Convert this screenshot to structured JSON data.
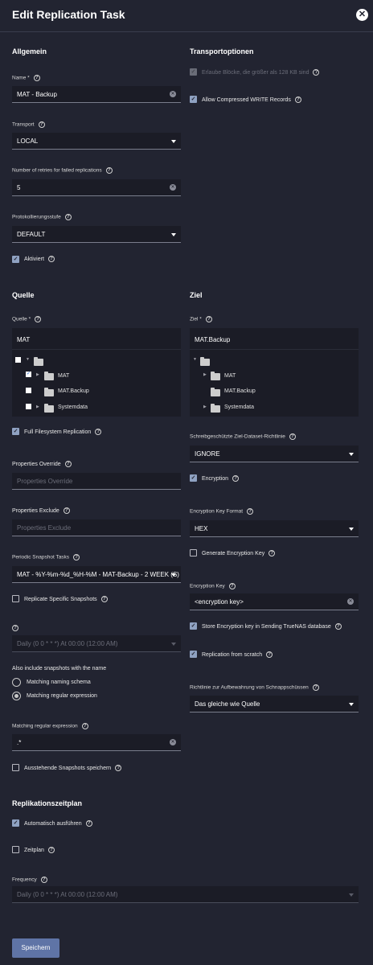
{
  "dialog": {
    "title": "Edit Replication Task",
    "close_icon": "close-icon"
  },
  "general": {
    "heading": "Allgemein",
    "name_label": "Name *",
    "name_value": "MAT - Backup",
    "transport_label": "Transport",
    "transport_value": "LOCAL",
    "retries_label": "Number of retries for failed replications",
    "retries_value": "5",
    "log_level_label": "Protokollierungsstufe",
    "log_level_value": "DEFAULT",
    "enabled_label": "Aktiviert"
  },
  "transport_options": {
    "heading": "Transportoptionen",
    "large_blocks_label": "Erlaube Blöcke, die größer als 128 KB sind",
    "compressed_label": "Allow Compressed WRITE Records"
  },
  "source": {
    "heading": "Quelle",
    "label": "Quelle *",
    "value": "MAT",
    "tree": [
      {
        "name": "MAT"
      },
      {
        "name": "MAT.Backup"
      },
      {
        "name": "Systemdata"
      }
    ],
    "full_fs_label": "Full Filesystem Replication",
    "props_override_label": "Properties Override",
    "props_override_placeholder": "Properties Override",
    "props_exclude_label": "Properties Exclude",
    "props_exclude_placeholder": "Properties Exclude",
    "periodic_label": "Periodic Snapshot Tasks",
    "periodic_value": "MAT - %Y-%m-%d_%H-%M - MAT-Backup - 2 WEEK (S) -...",
    "replicate_specific_label": "Replicate Specific Snapshots",
    "schedule_value": "Daily (0 0 * * *)  At 00:00 (12:00 AM)",
    "also_include_label": "Also include snapshots with the name",
    "radio_naming": "Matching naming schema",
    "radio_regex": "Matching regular expression",
    "regex_label": "Matching regular expression",
    "regex_value": ".*",
    "save_pending_label": "Ausstehende Snapshots speichern"
  },
  "target": {
    "heading": "Ziel",
    "label": "Ziel *",
    "value": "MAT.Backup",
    "tree": [
      {
        "name": "MAT"
      },
      {
        "name": "MAT.Backup"
      },
      {
        "name": "Systemdata"
      }
    ],
    "readonly_label": "Schreibgeschützte Ziel-Dataset-Richtlinie",
    "readonly_value": "IGNORE",
    "encryption_label": "Encryption",
    "key_format_label": "Encryption Key Format",
    "key_format_value": "HEX",
    "generate_key_label": "Generate Encryption Key",
    "key_label": "Encryption Key",
    "key_value": "<encryption key>",
    "store_key_label": "Store Encryption key in Sending TrueNAS database",
    "from_scratch_label": "Replication from scratch",
    "retention_label": "Richtlinie zur Aufbewahrung von Schnappschüssen",
    "retention_value": "Das gleiche wie Quelle"
  },
  "schedule": {
    "heading": "Replikationszeitplan",
    "auto_label": "Automatisch ausführen",
    "zeitplan_label": "Zeitplan",
    "frequency_label": "Frequency",
    "frequency_value": "Daily (0 0 * * *)  At 00:00 (12:00 AM)"
  },
  "footer": {
    "save_label": "Speichern"
  },
  "colors": {
    "background": "#222431",
    "input": "#1b1c26",
    "checkbox": "#8fa2c2",
    "button": "#5f74a6"
  }
}
